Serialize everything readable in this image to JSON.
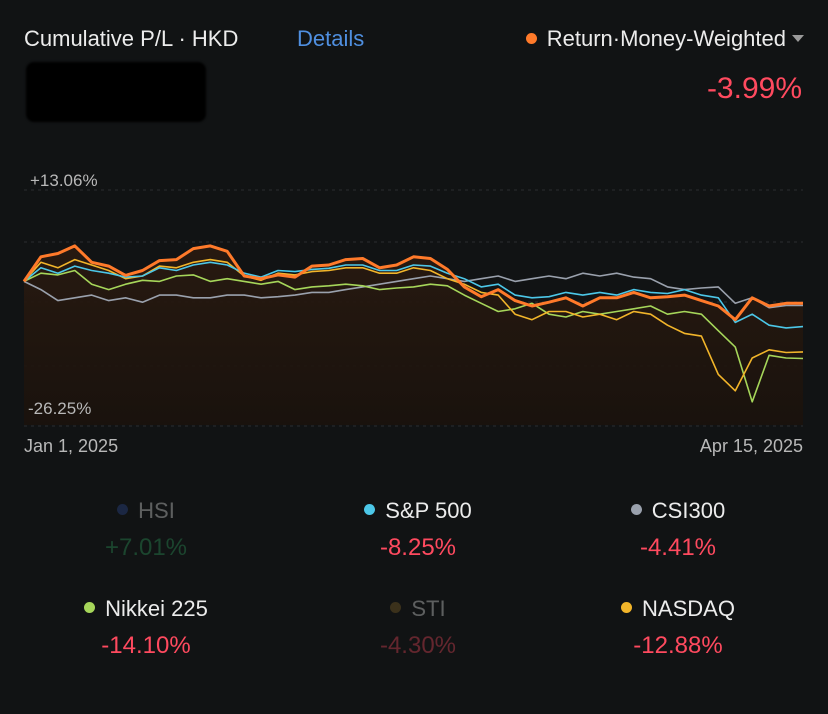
{
  "header": {
    "title": "Cumulative P/L · HKD",
    "details_label": "Details",
    "return_label": "Return·Money-Weighted",
    "return_value": "-3.99%"
  },
  "colors": {
    "portfolio": "#ff7a2a",
    "hsi": "#2f4d9c",
    "sp500": "#4cc7e8",
    "csi300": "#9aa1ad",
    "nikkei": "#a6d65a",
    "sti": "#8b6a2a",
    "nasdaq": "#f2b52a",
    "positive": "#2fa260",
    "negative": "#ff4a5f"
  },
  "chart_data": {
    "type": "line",
    "y_max_label": "+13.06%",
    "y_min_label": "-26.25%",
    "x_start_label": "Jan 1, 2025",
    "x_end_label": "Apr 15, 2025",
    "series": [
      {
        "name": "Return·Money-Weighted",
        "key": "portfolio",
        "values": [
          0,
          4.5,
          5.1,
          6.5,
          3.5,
          2.8,
          1.1,
          2.0,
          3.8,
          4.0,
          6.0,
          6.5,
          5.5,
          1.0,
          0.5,
          1.2,
          0.8,
          2.8,
          3.0,
          4.0,
          4.2,
          2.5,
          3.0,
          4.5,
          4.2,
          2.2,
          -1.0,
          -2.8,
          -1.5,
          -3.5,
          -4.5,
          -3.8,
          -3.0,
          -4.5,
          -3.0,
          -3.0,
          -2.0,
          -3.0,
          -2.8,
          -2.5,
          -3.5,
          -4.5,
          -7.0,
          -3.0,
          -4.5,
          -4.0,
          -3.99
        ]
      },
      {
        "name": "S&P 500",
        "key": "sp500",
        "values": [
          0,
          2.5,
          1.5,
          2.8,
          2.0,
          1.5,
          0.8,
          1.0,
          2.5,
          2.0,
          3.0,
          3.5,
          3.0,
          1.5,
          0.8,
          2.0,
          1.8,
          2.2,
          2.4,
          3.0,
          3.0,
          2.0,
          2.0,
          3.0,
          2.8,
          1.5,
          0.5,
          -1.0,
          -0.5,
          -2.5,
          -3.0,
          -2.8,
          -2.0,
          -2.5,
          -2.0,
          -2.5,
          -1.5,
          -2.0,
          -2.2,
          -1.5,
          -2.5,
          -3.0,
          -7.5,
          -6.0,
          -8.0,
          -8.5,
          -8.25
        ]
      },
      {
        "name": "CSI300",
        "key": "csi300",
        "values": [
          0,
          -1.5,
          -3.5,
          -3.0,
          -2.5,
          -3.5,
          -3.0,
          -3.8,
          -2.5,
          -2.5,
          -3.0,
          -3.0,
          -2.5,
          -2.5,
          -3.0,
          -2.8,
          -2.5,
          -2.0,
          -2.0,
          -1.5,
          -1.0,
          -0.5,
          0.0,
          0.5,
          1.0,
          0.5,
          0.0,
          0.5,
          1.0,
          0.0,
          0.5,
          1.0,
          0.5,
          1.5,
          1.0,
          1.5,
          0.8,
          0.5,
          -1.0,
          -1.5,
          -1.2,
          -1.0,
          -4.0,
          -3.0,
          -4.8,
          -4.4,
          -4.41
        ]
      },
      {
        "name": "Nikkei 225",
        "key": "nikkei",
        "values": [
          0,
          1.5,
          1.2,
          2.0,
          -0.5,
          -1.5,
          -0.5,
          0.2,
          0.0,
          1.0,
          1.2,
          0.0,
          0.5,
          0.0,
          -0.5,
          0.0,
          -1.5,
          -1.0,
          -0.8,
          -0.5,
          -0.8,
          -1.5,
          -1.2,
          -1.0,
          -0.5,
          -0.8,
          -2.5,
          -4.0,
          -5.5,
          -5.0,
          -4.0,
          -6.0,
          -6.5,
          -5.5,
          -6.0,
          -5.5,
          -5.0,
          -4.5,
          -6.0,
          -5.5,
          -6.0,
          -9.0,
          -12.0,
          -22.0,
          -13.5,
          -14.0,
          -14.1
        ]
      },
      {
        "name": "NASDAQ",
        "key": "nasdaq",
        "values": [
          0,
          3.5,
          2.5,
          4.0,
          3.0,
          2.0,
          0.5,
          1.0,
          2.8,
          2.5,
          3.5,
          4.0,
          3.5,
          1.0,
          0.2,
          1.5,
          1.2,
          1.8,
          2.0,
          2.5,
          2.5,
          1.5,
          1.5,
          2.5,
          2.0,
          0.5,
          -0.5,
          -2.0,
          -2.5,
          -6.0,
          -7.0,
          -5.5,
          -5.5,
          -6.5,
          -6.0,
          -7.0,
          -5.5,
          -6.0,
          -8.0,
          -9.5,
          -10.0,
          -17.0,
          -20.0,
          -14.0,
          -12.5,
          -13.0,
          -12.88
        ]
      }
    ]
  },
  "legend": [
    {
      "name": "HSI",
      "key": "hsi",
      "value": "+7.01%",
      "sign": "positive",
      "dimmed": true
    },
    {
      "name": "S&P 500",
      "key": "sp500",
      "value": "-8.25%",
      "sign": "negative",
      "dimmed": false
    },
    {
      "name": "CSI300",
      "key": "csi300",
      "value": "-4.41%",
      "sign": "negative",
      "dimmed": false
    },
    {
      "name": "Nikkei 225",
      "key": "nikkei",
      "value": "-14.10%",
      "sign": "negative",
      "dimmed": false
    },
    {
      "name": "STI",
      "key": "sti",
      "value": "-4.30%",
      "sign": "negative",
      "dimmed": true
    },
    {
      "name": "NASDAQ",
      "key": "nasdaq",
      "value": "-12.88%",
      "sign": "negative",
      "dimmed": false
    }
  ]
}
